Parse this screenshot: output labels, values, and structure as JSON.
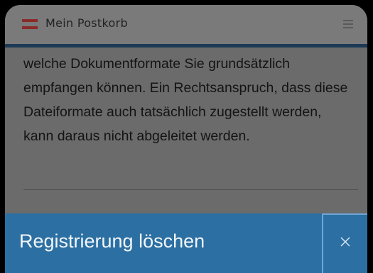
{
  "header": {
    "title": "Mein Postkorb",
    "logo_icon": "austria-flag-icon",
    "menu_icon": "hamburger-menu-icon"
  },
  "content": {
    "lines": [
      "welche Dokumentformate Sie grundsätzlich",
      "empfangen können. Ein Rechtsanspruch, dass diese",
      "Dateiformate auch tatsächlich zugestellt werden,",
      "kann daraus nicht abgeleitet werden."
    ]
  },
  "dialog": {
    "title": "Registrierung löschen",
    "close_icon": "close-icon"
  },
  "colors": {
    "header_accent": "#1c3a55",
    "dialog_background": "#2c6fa3",
    "flag_red": "#8a2b2b",
    "overlay": "#6b6b6b"
  }
}
